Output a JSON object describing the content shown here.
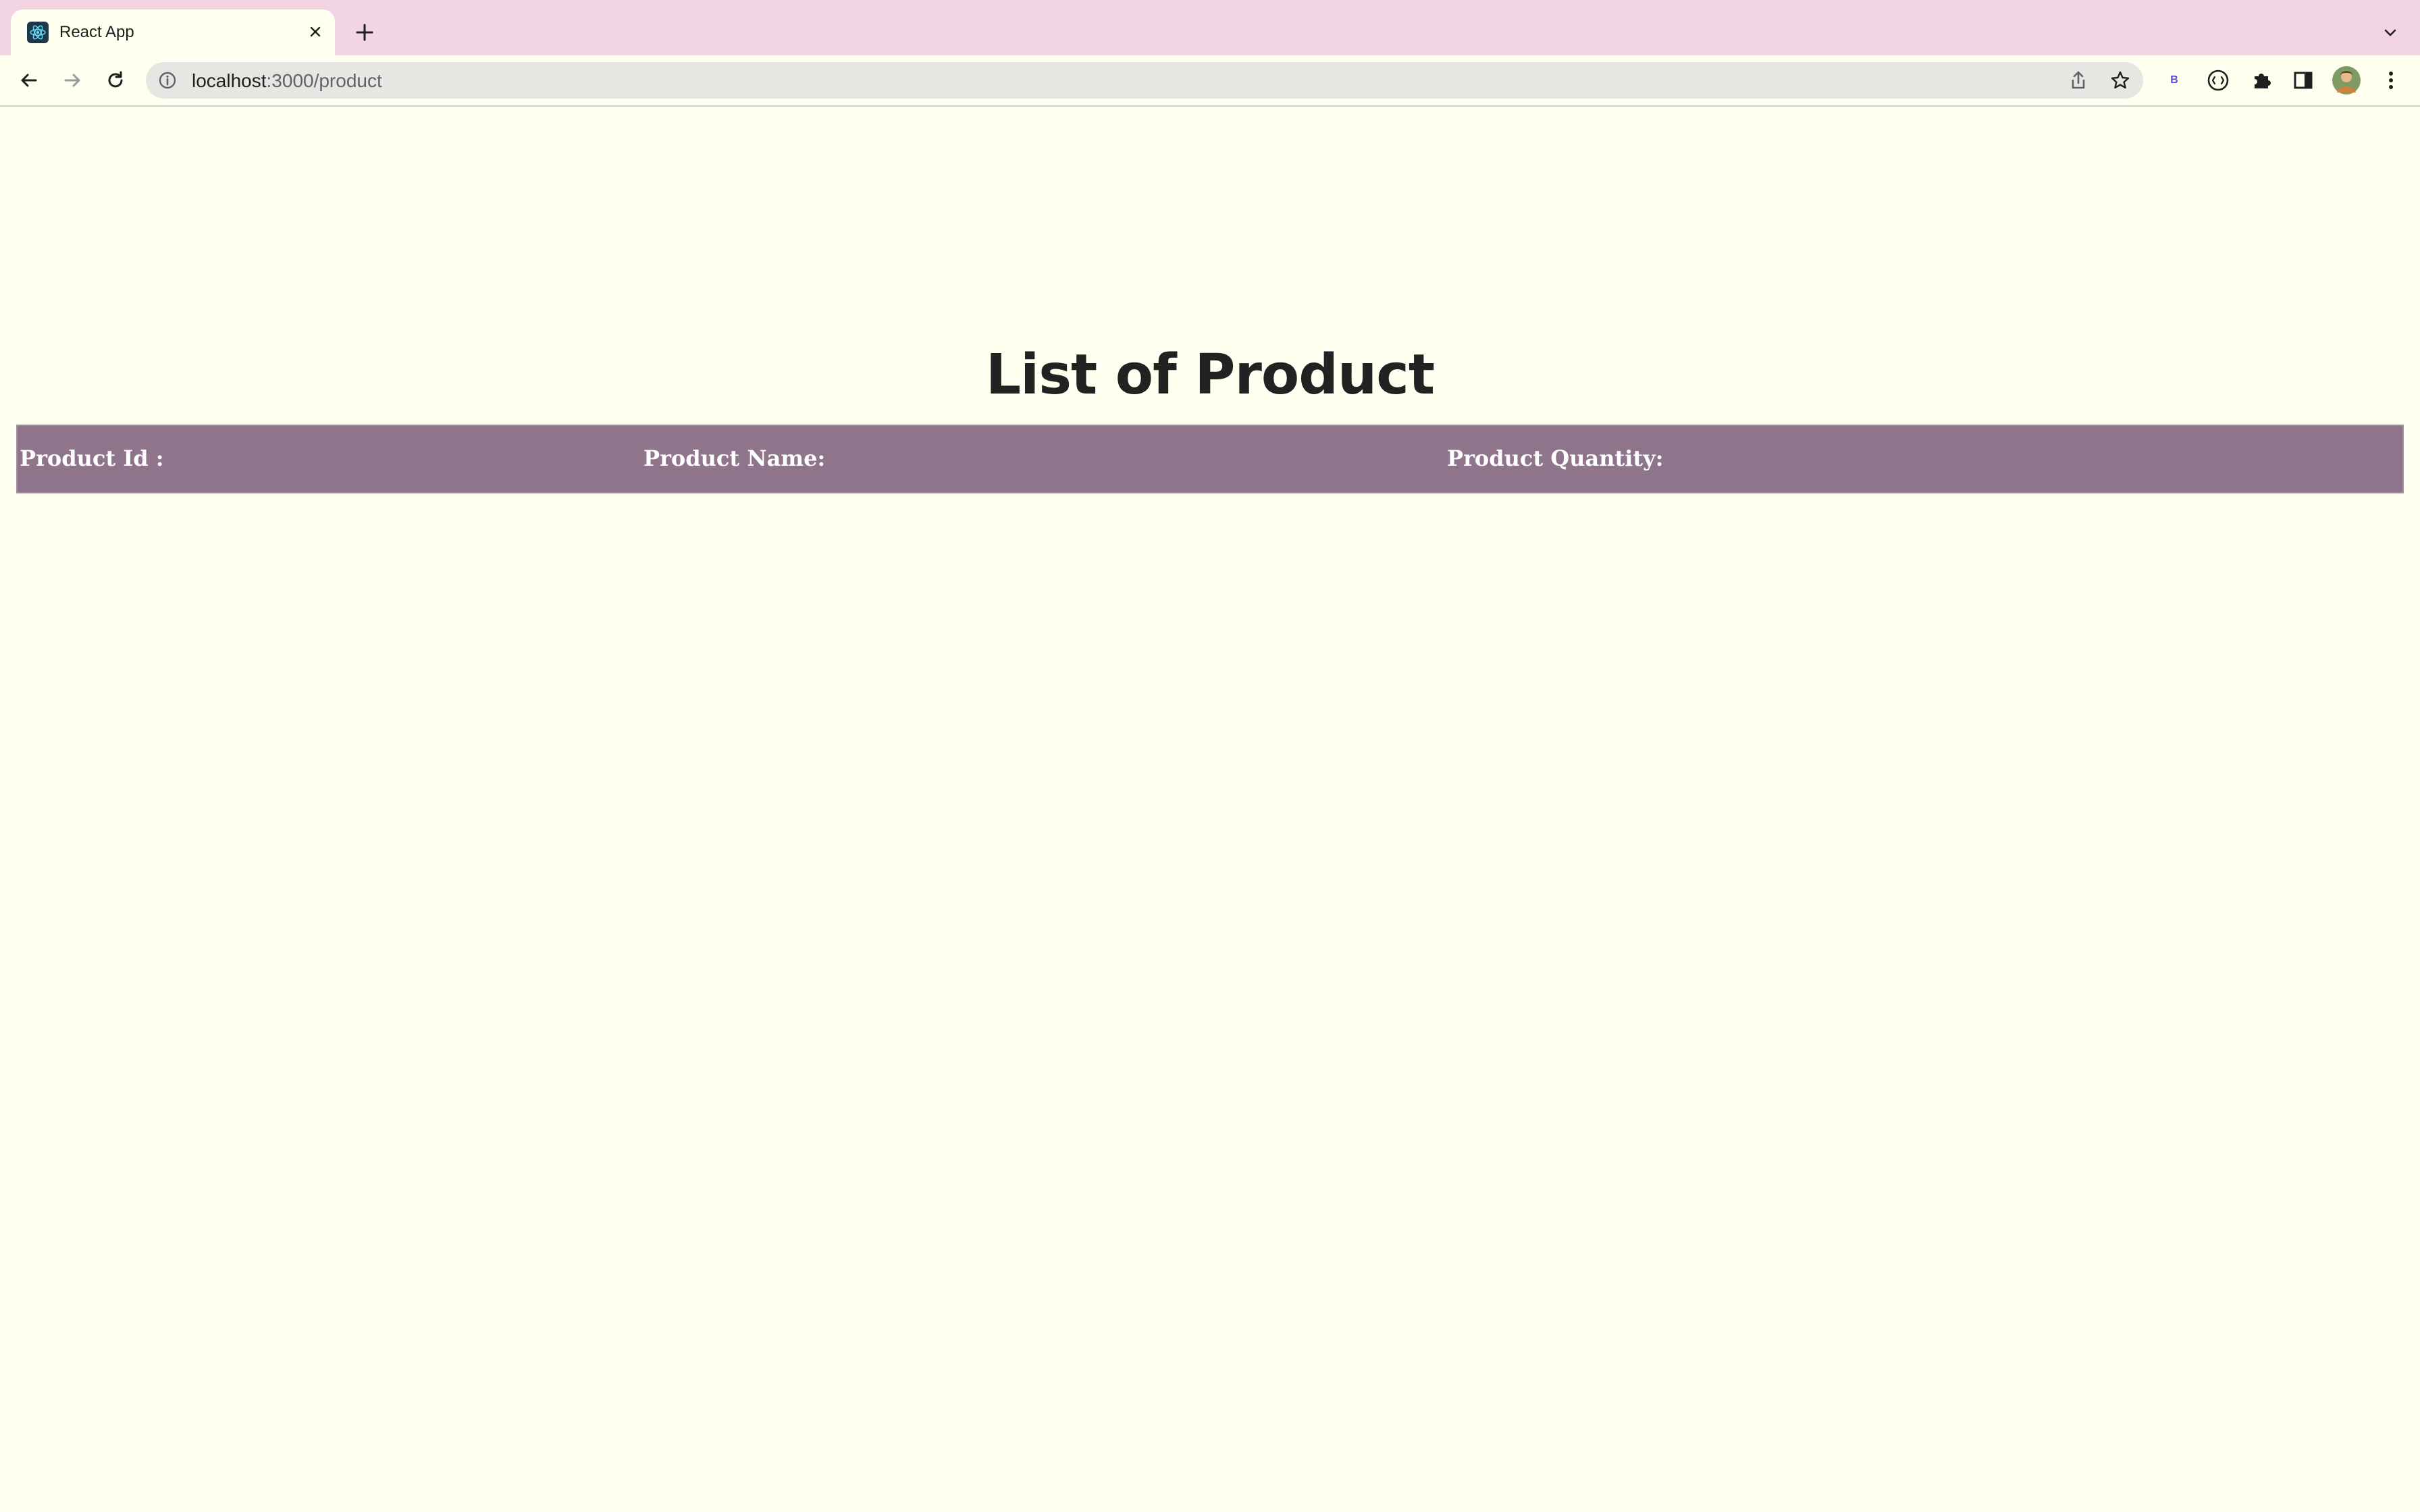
{
  "browser": {
    "tab": {
      "title": "React App",
      "favicon": "react-logo-icon"
    },
    "new_tab_icon": "plus-icon",
    "tab_search_icon": "chevron-down-icon",
    "url": {
      "host": "localhost",
      "path": ":3000/product"
    },
    "toolbar_icons": [
      "back-icon",
      "forward-icon",
      "reload-icon",
      "info-icon",
      "share-icon",
      "star-icon",
      "extension-b-icon",
      "extension-code-icon",
      "puzzle-icon",
      "side-panel-icon",
      "avatar",
      "kebab-menu-icon"
    ],
    "extension_b_label": "B"
  },
  "page": {
    "title": "List of Product",
    "table": {
      "headers": [
        "Product Id :",
        "Product Name:",
        "Product Quantity:"
      ],
      "rows": []
    }
  },
  "colors": {
    "page_bg": "#fffff0",
    "tabstrip_bg": "#f2d4e2",
    "table_header_bg": "#8f758b"
  }
}
